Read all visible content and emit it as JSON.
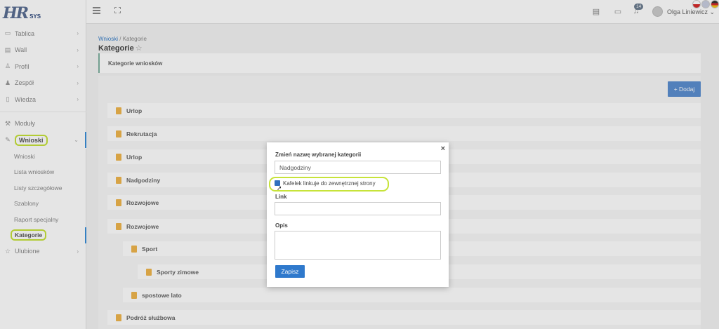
{
  "logo": {
    "main": "HR",
    "sub": "SYS"
  },
  "sidebar": {
    "items": [
      {
        "label": "Tablica",
        "icon": "monitor-icon",
        "chevron": "›"
      },
      {
        "label": "Wall",
        "icon": "wall-icon",
        "chevron": "›"
      },
      {
        "label": "Profil",
        "icon": "user-icon",
        "chevron": "›"
      },
      {
        "label": "Zespół",
        "icon": "team-icon",
        "chevron": "›"
      },
      {
        "label": "Wiedza",
        "icon": "book-icon",
        "chevron": "›"
      }
    ],
    "moduly": "Moduły",
    "wnioski": {
      "label": "Wnioski",
      "chevron": "⌄"
    },
    "sub_items": [
      "Wnioski",
      "Lista wniosków",
      "Listy szczegółowe",
      "Szablony",
      "Raport specjalny",
      "Kategorie"
    ],
    "ulubione": {
      "label": "Ulubione",
      "chevron": "›"
    }
  },
  "topbar": {
    "badge": "14",
    "username": "Olga Liniewicz ⌄"
  },
  "main": {
    "breadcrumb": {
      "link": "Wnioski",
      "sep": " / ",
      "current": "Kategorie"
    },
    "title": "Kategorie",
    "tab": "Kategorie wniosków",
    "add_button": "+ Dodaj",
    "categories": [
      "Urlop",
      "Rekrutacja",
      "Urlop",
      "Nadgodziny",
      "Rozwojowe",
      "Rozwojowe",
      "Sport",
      "Sporty zimowe",
      "spostowe lato",
      "Podróż służbowa"
    ]
  },
  "modal": {
    "close": "×",
    "rename_label": "Zmień nazwę wybranej kategorii",
    "rename_value": "Nadgodziny",
    "checkbox_label": "Kafelek linkuje do zewnętrznej strony",
    "link_label": "Link",
    "link_value": "",
    "opis_label": "Opis",
    "opis_value": "",
    "save_button": "Zapisz"
  },
  "colors": {
    "accent": "#2f79cc",
    "highlight": "#c7e33a",
    "folder": "#f0b64d"
  }
}
